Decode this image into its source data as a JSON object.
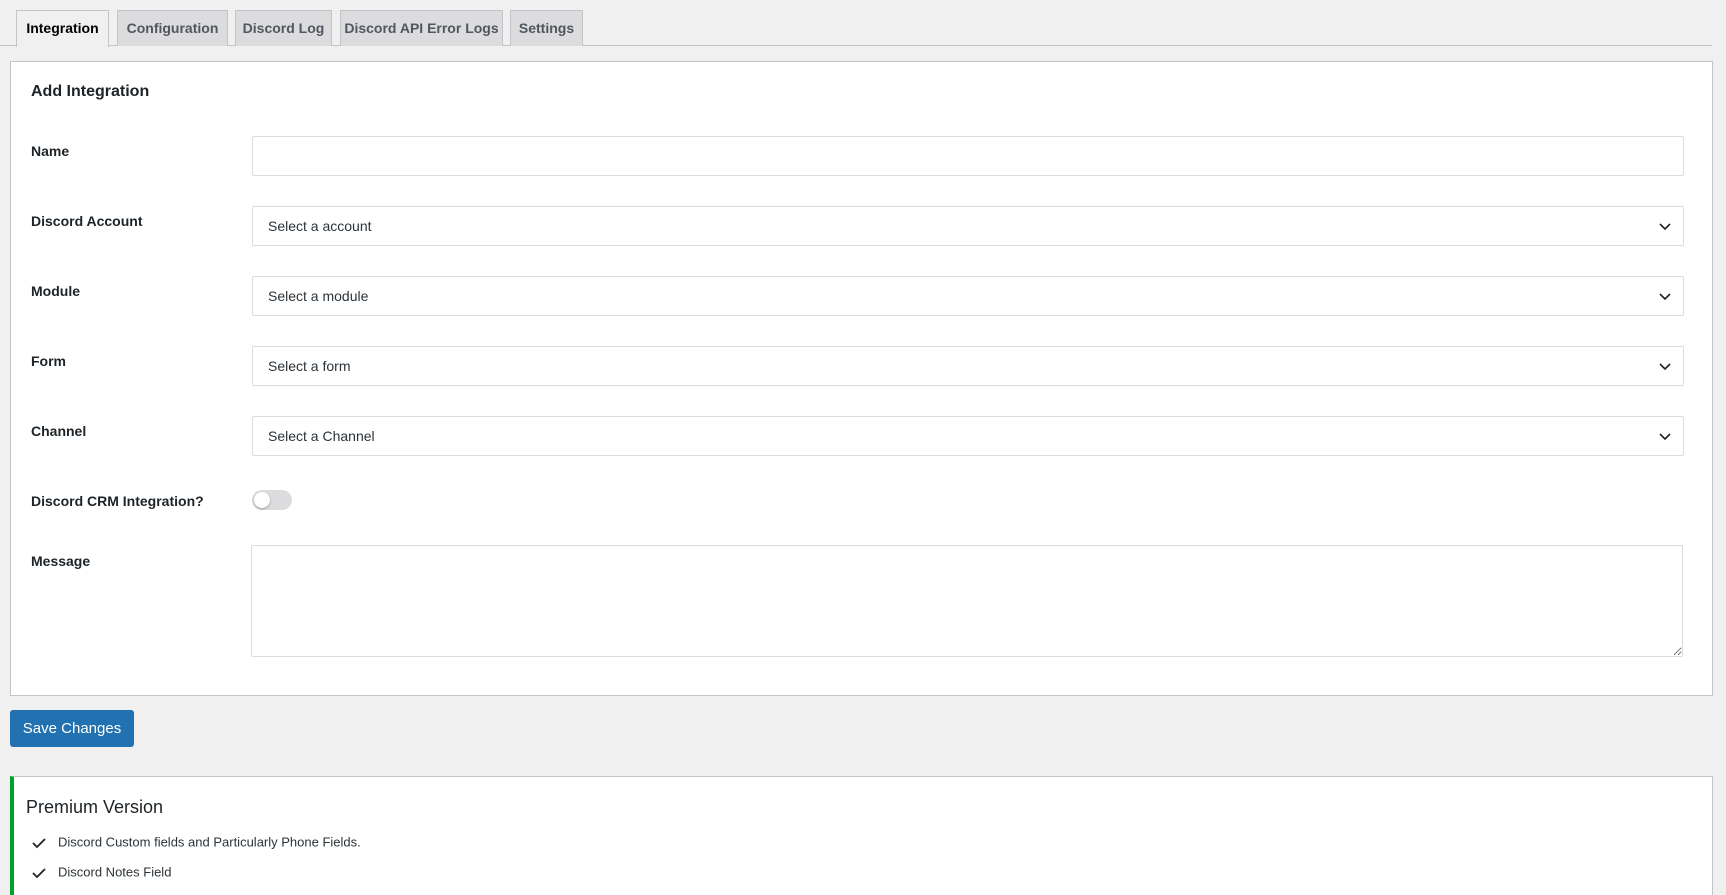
{
  "tabs": [
    {
      "label": "Integration",
      "active": true
    },
    {
      "label": "Configuration",
      "active": false
    },
    {
      "label": "Discord Log",
      "active": false
    },
    {
      "label": "Discord API Error Logs",
      "active": false
    },
    {
      "label": "Settings",
      "active": false
    }
  ],
  "form": {
    "title": "Add Integration",
    "name_label": "Name",
    "name_value": "",
    "account_label": "Discord Account",
    "account_value": "Select a account",
    "module_label": "Module",
    "module_value": "Select a module",
    "form_label": "Form",
    "form_value": "Select a form",
    "channel_label": "Channel",
    "channel_value": "Select a Channel",
    "crm_label": "Discord CRM Integration?",
    "crm_enabled": false,
    "message_label": "Message",
    "message_value": ""
  },
  "save_label": "Save Changes",
  "premium": {
    "title": "Premium Version",
    "features": [
      "Discord Custom fields and Particularly Phone Fields.",
      "Discord Notes Field"
    ]
  },
  "colors": {
    "primary": "#2271b1",
    "premium_accent": "#00a32a",
    "background": "#f0f0f1"
  }
}
